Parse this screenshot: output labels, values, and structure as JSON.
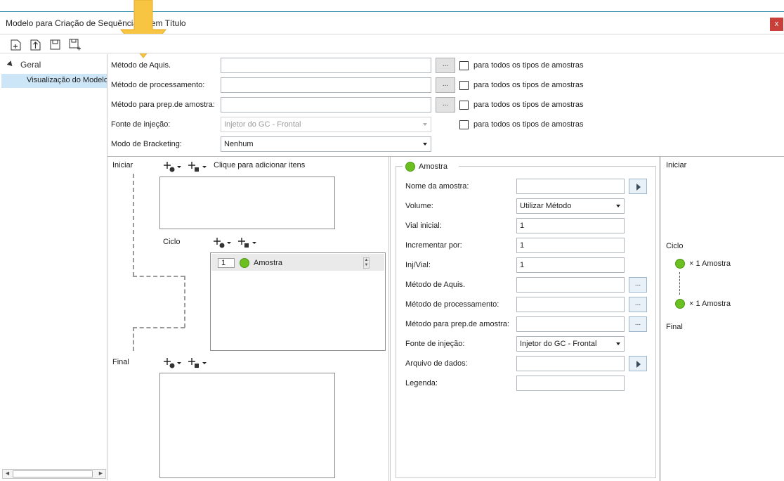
{
  "window": {
    "title": "Modelo para Criação de Sequência - Sem Título",
    "close_label": "x"
  },
  "toolbar": {
    "icons": [
      "new-icon",
      "open-icon",
      "save-icon",
      "save-as-icon"
    ]
  },
  "tree": {
    "root_label": "Geral",
    "selected_item": "Visualização do Modelo"
  },
  "methods": {
    "acq_label": "Método de Aquis.",
    "proc_label": "Método de processamento:",
    "prep_label": "Método para prep.de amostra:",
    "inj_label": "Fonte de injeção:",
    "brack_label": "Modo de Bracketing:",
    "acq_value": "",
    "proc_value": "",
    "prep_value": "",
    "inj_value": "Injetor do GC - Frontal",
    "brack_value": "Nenhum",
    "browse_label": "...",
    "all_types_label": "para todos os tipos de amostras"
  },
  "sequence": {
    "start_label": "Iniciar",
    "add_hint": "Clique para adicionar itens",
    "cycle_label": "Ciclo",
    "final_label": "Final",
    "cycle_item_count": "1",
    "cycle_item_name": "Amostra"
  },
  "sample": {
    "group_title": "Amostra",
    "name_label": "Nome da amostra:",
    "name_value": "",
    "volume_label": "Volume:",
    "volume_value": "Utilizar Método",
    "vial_label": "Vial inicial:",
    "vial_value": "1",
    "incr_label": "Incrementar por:",
    "incr_value": "1",
    "injvial_label": "Inj/Vial:",
    "injvial_value": "1",
    "acq_label": "Método de Aquis.",
    "acq_value": "",
    "proc_label": "Método de processamento:",
    "proc_value": "",
    "prep_label": "Método para prep.de amostra:",
    "prep_value": "",
    "inj_label": "Fonte de injeção:",
    "inj_value": "Injetor do GC - Frontal",
    "file_label": "Arquivo de dados:",
    "file_value": "",
    "legend_label": "Legenda:",
    "legend_value": "",
    "browse_label": "..."
  },
  "preview": {
    "start_label": "Iniciar",
    "cycle_label": "Ciclo",
    "item1": "× 1  Amostra",
    "item2": "× 1  Amostra",
    "final_label": "Final"
  },
  "colors": {
    "accent": "#2f8fa8",
    "selection": "#cde6f7",
    "sample_green": "#6bbf21",
    "close_red": "#c9403a",
    "hint_arrow": "#f7c542"
  }
}
